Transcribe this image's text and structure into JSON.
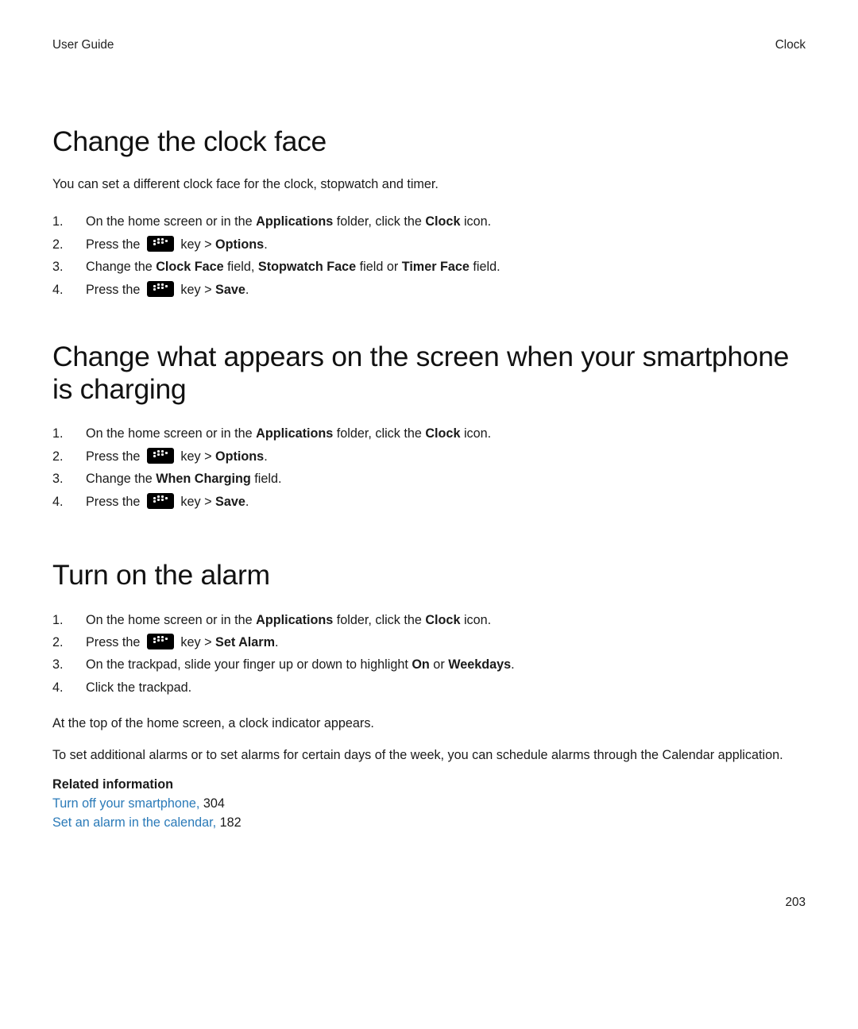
{
  "header": {
    "left": "User Guide",
    "right": "Clock"
  },
  "page_number": "203",
  "sections": [
    {
      "title": "Change the clock face",
      "intro": "You can set a different clock face for the clock, stopwatch and timer.",
      "steps": [
        {
          "pre": "On the home screen or in the ",
          "b1": "Applications",
          "mid1": " folder, click the ",
          "b2": "Clock",
          "tail": " icon."
        },
        {
          "pre": "Press the ",
          "key": true,
          "mid1": " key > ",
          "b1": "Options",
          "tail": "."
        },
        {
          "pre": "Change the ",
          "b1": "Clock Face",
          "mid1": " field, ",
          "b2": "Stopwatch Face",
          "mid2": " field or ",
          "b3": "Timer Face",
          "tail": " field."
        },
        {
          "pre": "Press the ",
          "key": true,
          "mid1": " key > ",
          "b1": "Save",
          "tail": "."
        }
      ]
    },
    {
      "title": "Change what appears on the screen when your smartphone is charging",
      "steps": [
        {
          "pre": "On the home screen or in the ",
          "b1": "Applications",
          "mid1": " folder, click the ",
          "b2": "Clock",
          "tail": " icon."
        },
        {
          "pre": "Press the ",
          "key": true,
          "mid1": " key > ",
          "b1": "Options",
          "tail": "."
        },
        {
          "pre": "Change the ",
          "b1": "When Charging",
          "tail": " field."
        },
        {
          "pre": "Press the ",
          "key": true,
          "mid1": " key > ",
          "b1": "Save",
          "tail": "."
        }
      ]
    },
    {
      "title": "Turn on the alarm",
      "steps": [
        {
          "pre": "On the home screen or in the ",
          "b1": "Applications",
          "mid1": " folder, click the ",
          "b2": "Clock",
          "tail": " icon."
        },
        {
          "pre": "Press the ",
          "key": true,
          "mid1": " key > ",
          "b1": "Set Alarm",
          "tail": "."
        },
        {
          "pre": "On the trackpad, slide your finger up or down to highlight ",
          "b1": "On",
          "mid1": " or ",
          "b2": "Weekdays",
          "tail": "."
        },
        {
          "pre": "Click the trackpad."
        }
      ],
      "after_paras": [
        "At the top of the home screen, a clock indicator appears.",
        "To set additional alarms or to set alarms for certain days of the week, you can schedule alarms through the Calendar application."
      ],
      "related_heading": "Related information",
      "related_links": [
        {
          "text": "Turn off your smartphone,",
          "page": "304"
        },
        {
          "text": "Set an alarm in the calendar,",
          "page": "182"
        }
      ]
    }
  ]
}
